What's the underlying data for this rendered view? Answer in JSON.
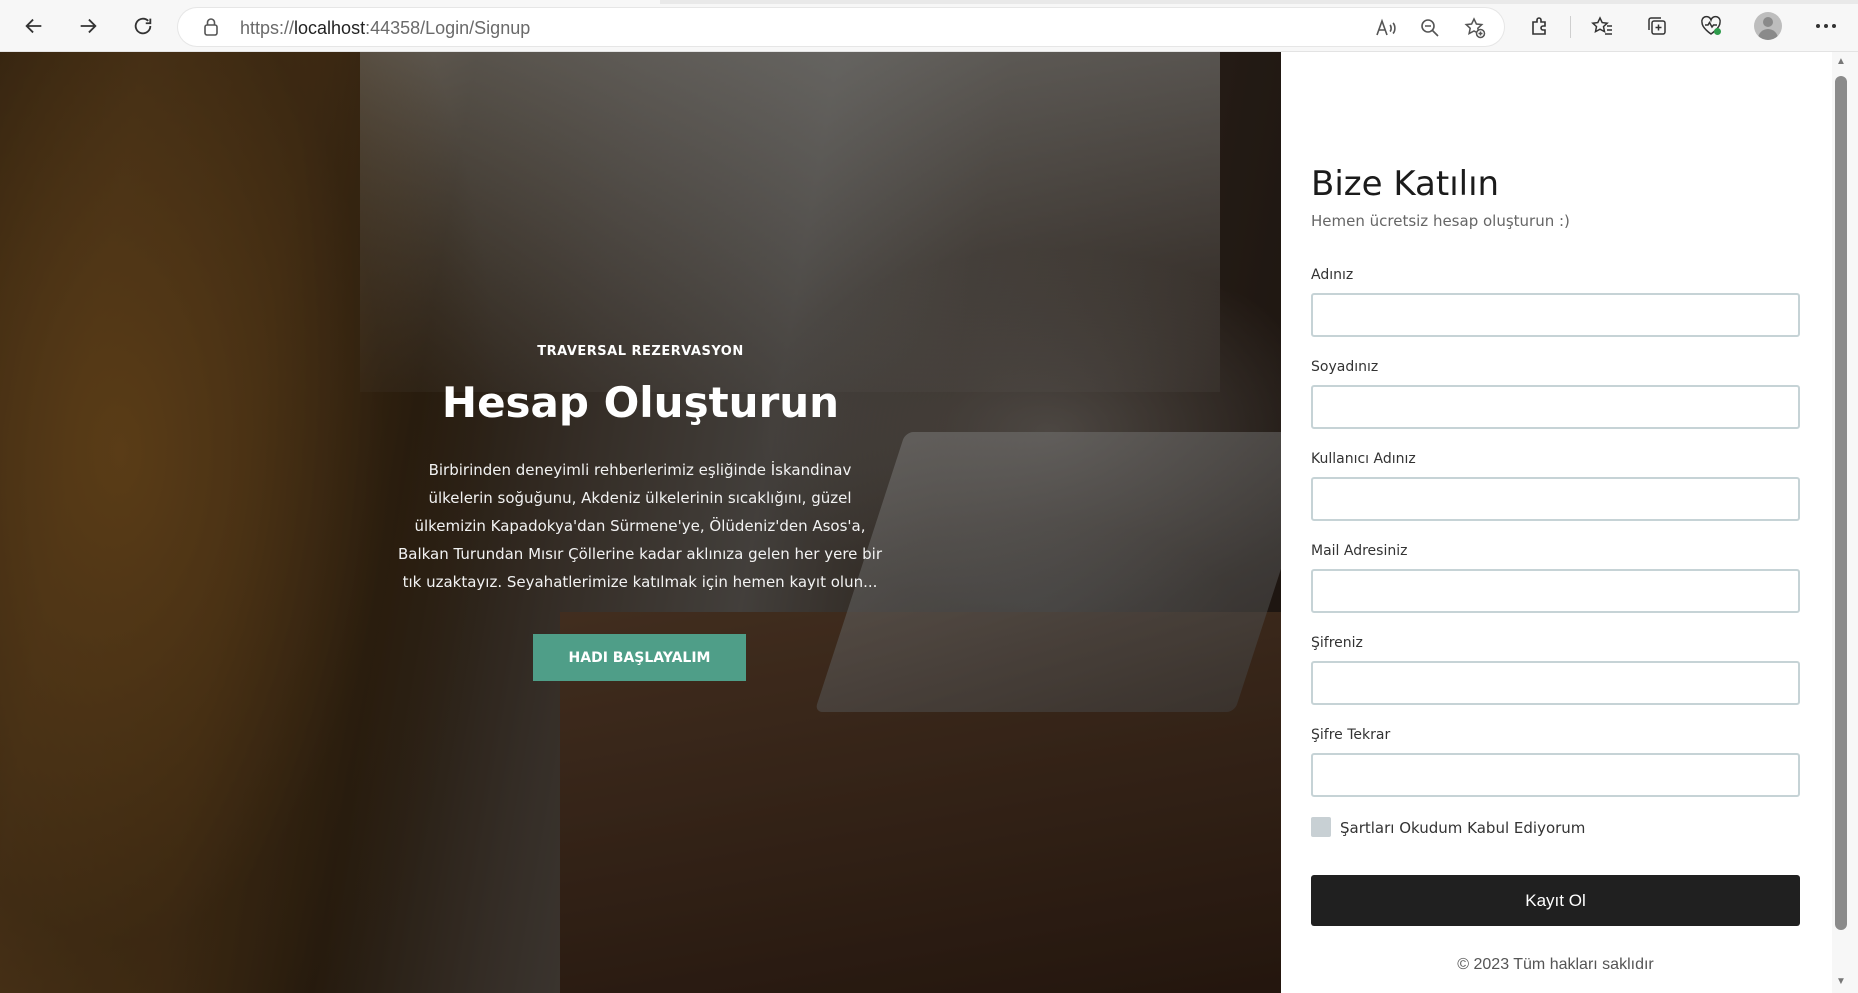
{
  "browser": {
    "url_prefix": "https://",
    "url_host": "localhost",
    "url_rest": ":44358/Login/Signup"
  },
  "hero": {
    "brand": "TRAVERSAL REZERVASYON",
    "title": "Hesap Oluşturun",
    "description": "Birbirinden deneyimli rehberlerimiz eşliğinde İskandinav ülkelerin soğuğunu, Akdeniz ülkelerinin sıcaklığını, güzel ülkemizin Kapadokya'dan Sürmene'ye, Ölüdeniz'den Asos'a, Balkan Turundan Mısır Çöllerine kadar aklınıza gelen her yere bir tık uzaktayız. Seyahatlerimize katılmak için hemen kayıt olun...",
    "cta_label": "HADI BAŞLAYALIM",
    "accent": "#4f9e88"
  },
  "form": {
    "title": "Bize Katılın",
    "subtitle": "Hemen ücretsiz hesap oluşturun :)",
    "fields": [
      {
        "label": "Adınız",
        "value": ""
      },
      {
        "label": "Soyadınız",
        "value": ""
      },
      {
        "label": "Kullanıcı Adınız",
        "value": ""
      },
      {
        "label": "Mail Adresiniz",
        "value": ""
      },
      {
        "label": "Şifreniz",
        "value": ""
      },
      {
        "label": "Şifre Tekrar",
        "value": ""
      }
    ],
    "terms_label": "Şartları Okudum Kabul Ediyorum",
    "submit_label": "Kayıt Ol",
    "footer": "© 2023 Tüm hakları saklıdır"
  },
  "icons": [
    "back-icon",
    "forward-icon",
    "refresh-icon",
    "lock-icon",
    "read-aloud-icon",
    "zoom-out-icon",
    "add-favorite-icon",
    "extensions-icon",
    "favorites-icon",
    "collections-icon",
    "browser-essentials-icon",
    "profile-avatar-icon",
    "more-icon"
  ]
}
